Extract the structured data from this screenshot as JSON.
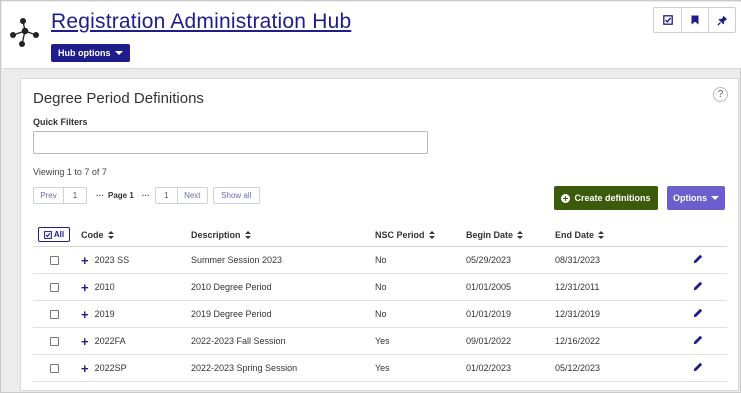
{
  "header": {
    "title": "Registration Administration Hub",
    "hub_options_label": "Hub options",
    "tools": [
      "checklist-icon",
      "bookmark-icon",
      "pin-icon"
    ]
  },
  "panel": {
    "title": "Degree Period Definitions",
    "help_glyph": "?",
    "quick_filters_label": "Quick Filters",
    "quick_filter_value": "",
    "viewing_text": "Viewing 1 to 7 of 7"
  },
  "pager": {
    "prev": "Prev",
    "first": "1",
    "dots": "···",
    "page_text": "Page 1",
    "dots2": "···",
    "current": "1",
    "next": "Next",
    "show_all": "Show all"
  },
  "actions": {
    "create": "Create definitions",
    "options": "Options"
  },
  "table": {
    "all_label": "All",
    "columns": [
      "Code",
      "Description",
      "NSC Period",
      "Begin Date",
      "End Date"
    ],
    "rows": [
      {
        "code": "2023 SS",
        "description": "Summer Session 2023",
        "nsc": "No",
        "begin": "05/29/2023",
        "end": "08/31/2023"
      },
      {
        "code": "2010",
        "description": "2010 Degree Period",
        "nsc": "No",
        "begin": "01/01/2005",
        "end": "12/31/2011"
      },
      {
        "code": "2019",
        "description": "2019 Degree Period",
        "nsc": "No",
        "begin": "01/01/2019",
        "end": "12/31/2019"
      },
      {
        "code": "2022FA",
        "description": "2022-2023 Fall Session",
        "nsc": "Yes",
        "begin": "09/01/2022",
        "end": "12/16/2022"
      },
      {
        "code": "2022SP",
        "description": "2022-2023 Spring Session",
        "nsc": "Yes",
        "begin": "01/02/2023",
        "end": "05/12/2023"
      }
    ]
  },
  "colors": {
    "brand": "#1f1d8c",
    "create_button": "#3b5a0c",
    "options_button": "#6a5fcc"
  }
}
